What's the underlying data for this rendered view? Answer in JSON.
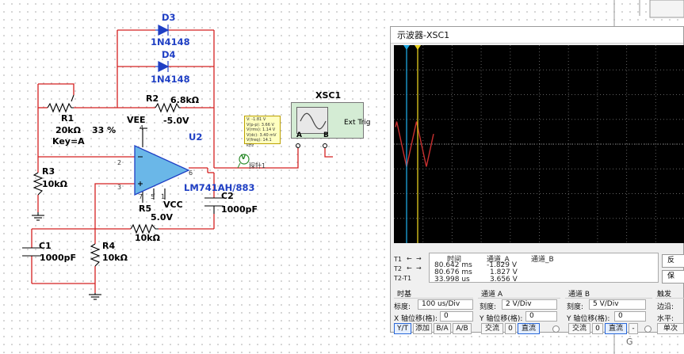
{
  "components": {
    "d3": {
      "ref": "D3",
      "model": "1N4148"
    },
    "d4": {
      "ref": "D4",
      "model": "1N4148"
    },
    "r1": {
      "ref": "R1",
      "value": "20kΩ",
      "percent": "33 %",
      "key": "Key=A"
    },
    "r2": {
      "ref": "R2",
      "value": "6.8kΩ"
    },
    "r3": {
      "ref": "R3",
      "value": "10kΩ"
    },
    "r4": {
      "ref": "R4",
      "value": "10kΩ"
    },
    "r5": {
      "ref": "R5",
      "value": "10kΩ"
    },
    "c1": {
      "ref": "C1",
      "value": "1000pF"
    },
    "c2": {
      "ref": "C2",
      "value": "1000pF"
    },
    "u2": {
      "ref": "U2",
      "model": "LM741AH/883"
    },
    "vee": {
      "label": "VEE",
      "value": "-5.0V"
    },
    "vcc": {
      "label": "VCC",
      "value": "5.0V"
    },
    "pins": {
      "p2": "2",
      "p3": "3",
      "p4": "4",
      "p5": "5",
      "p6": "6",
      "p7": "7",
      "p1": "1"
    },
    "probe": {
      "name": "探针1",
      "symbol": "V",
      "lines": [
        "V: -1.81 V",
        "V(p-p): 3.66 V",
        "V(rms): 1.14 V",
        "V(dc): 3.40 mV",
        "V(freq): 14.1 kHz"
      ]
    },
    "xsc1": {
      "ref": "XSC1",
      "ext_trig": "Ext Trig",
      "a": "A",
      "b": "B"
    }
  },
  "right_strip": {
    "label": "G"
  },
  "oscilloscope": {
    "title": "示波器-XSC1",
    "readout": {
      "headers": {
        "time": "时间",
        "ch_a": "通道_A",
        "ch_b": "通道_B"
      },
      "rows": [
        {
          "label": "T1",
          "time": "80.642 ms",
          "ch_a": "-1.829 V",
          "ch_b": ""
        },
        {
          "label": "T2",
          "time": "80.676 ms",
          "ch_a": "1.827 V",
          "ch_b": ""
        },
        {
          "label": "T2-T1",
          "time": "33.998 us",
          "ch_a": "3.656 V",
          "ch_b": ""
        }
      ],
      "arrows": {
        "left": "←",
        "right": "→"
      },
      "side_buttons": [
        "反",
        "保"
      ]
    },
    "timebase": {
      "title": "时基",
      "scale_label": "标度:",
      "scale_value": "100 us/Div",
      "xpos_label": "X 轴位移(格):",
      "xpos_value": "0",
      "buttons": [
        "Y/T",
        "添加",
        "B/A",
        "A/B"
      ]
    },
    "channel_a": {
      "title": "通道 A",
      "scale_label": "刻度:",
      "scale_value": "2  V/Div",
      "ypos_label": "Y 轴位移(格):",
      "ypos_value": "0",
      "buttons": [
        "交流",
        "0",
        "直流"
      ]
    },
    "channel_b": {
      "title": "通道 B",
      "scale_label": "刻度:",
      "scale_value": "5  V/Div",
      "ypos_label": "Y 轴位移(格):",
      "ypos_value": "0",
      "buttons": [
        "交流",
        "0",
        "直流",
        "-"
      ]
    },
    "trigger": {
      "title": "触发",
      "edge_label": "边沿:",
      "level_label": "水平:",
      "single_button": "单次"
    }
  },
  "colors": {
    "wire": "#d42020",
    "label_blue": "#1f3fc4",
    "trace_a": "#c83030",
    "cursor1": "#1da6e0",
    "cursor2": "#e8d020",
    "screen_grid": "#606060"
  }
}
